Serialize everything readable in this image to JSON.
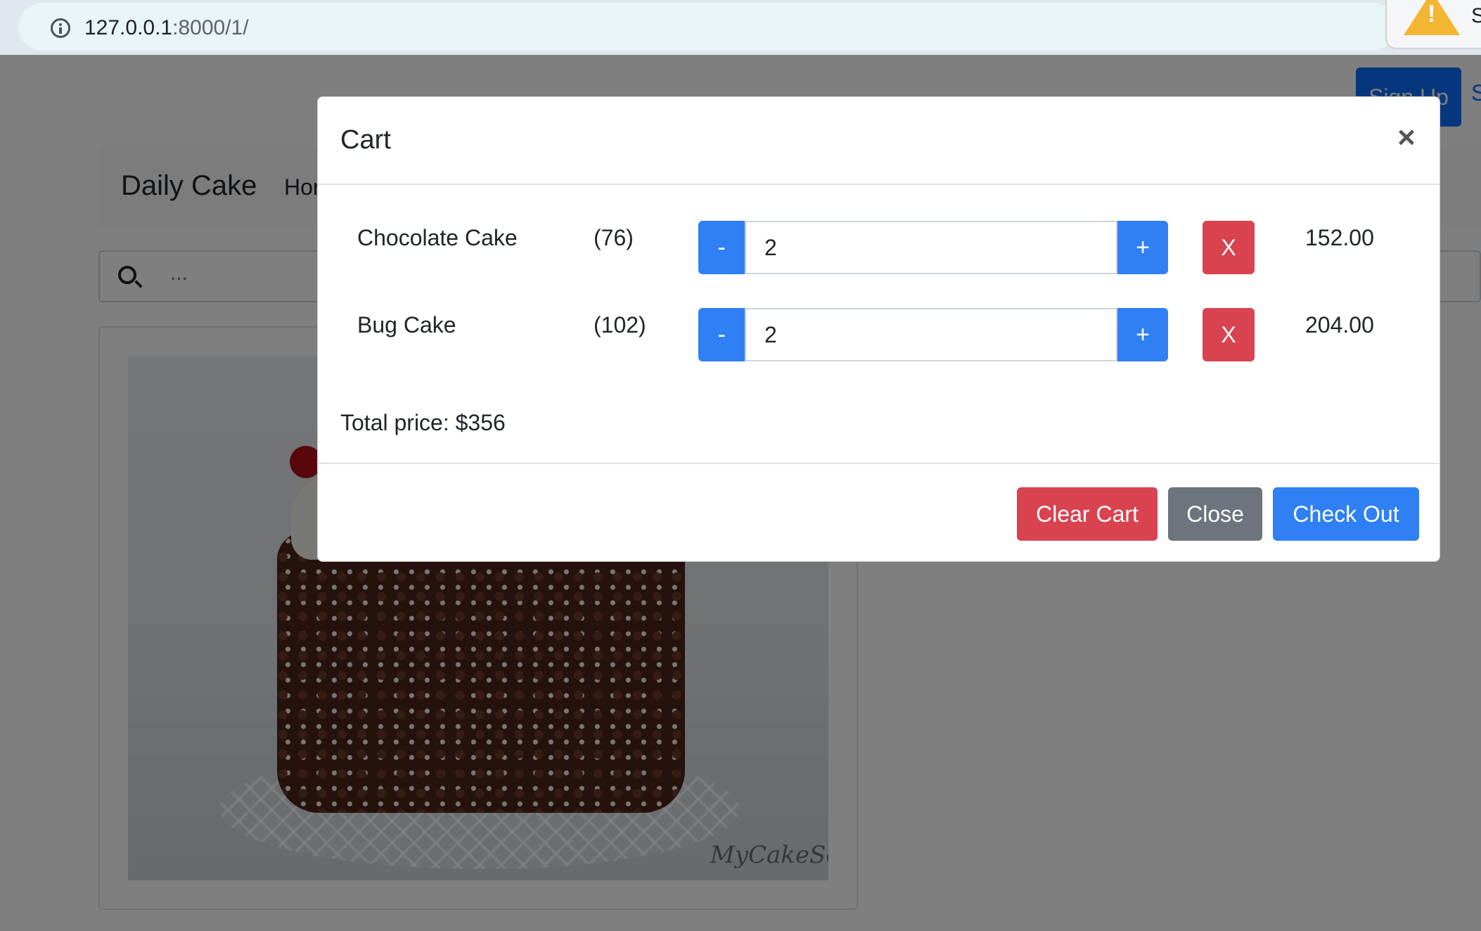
{
  "browser": {
    "url_host": "127.0.0.1",
    "url_path": ":8000/1/",
    "warning_icon": "warning-triangle-icon",
    "warning_text": "S"
  },
  "page": {
    "signup_label": "Sign Up",
    "signin_label": "S",
    "brand": "Daily Cake",
    "nav_home": "Hor",
    "search_placeholder": "...",
    "watermark": "MyCakeSc"
  },
  "cart": {
    "title": "Cart",
    "items": [
      {
        "name": "Chocolate Cake",
        "id": "(76)",
        "quantity": "2",
        "minus": "-",
        "plus": "+",
        "remove": "X",
        "price": "152.00"
      },
      {
        "name": "Bug Cake",
        "id": "(102)",
        "quantity": "2",
        "minus": "-",
        "plus": "+",
        "remove": "X",
        "price": "204.00"
      }
    ],
    "total": "Total price: $356",
    "buttons": {
      "clear": "Clear Cart",
      "close": "Close",
      "checkout": "Check Out"
    }
  },
  "colors": {
    "primary": "#2f80f5",
    "danger": "#d9434f",
    "secondary": "#6c757d"
  }
}
